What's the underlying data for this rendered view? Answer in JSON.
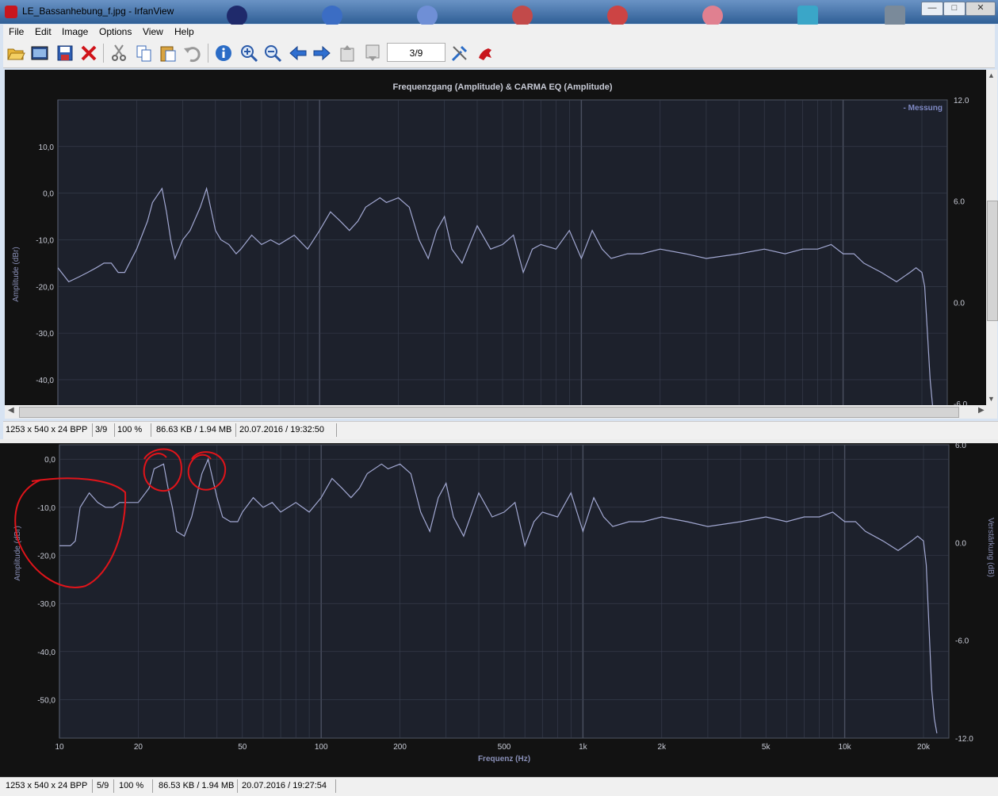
{
  "window": {
    "title": "LE_Bassanhebung_f.jpg - IrfanView",
    "controls": {
      "minimize": "—",
      "maximize": "□",
      "close": "✕"
    }
  },
  "menu": [
    "File",
    "Edit",
    "Image",
    "Options",
    "View",
    "Help"
  ],
  "toolbar": {
    "page_field": "3/9",
    "icons": [
      "open-folder-icon",
      "thumbnails-icon",
      "save-icon",
      "delete-icon",
      "cut-icon",
      "copy-icon",
      "paste-icon",
      "undo-icon",
      "info-icon",
      "zoom-in-icon",
      "zoom-out-icon",
      "previous-icon",
      "next-icon",
      "first-page-icon",
      "last-page-icon",
      "settings-icon",
      "irfanview-logo-icon"
    ]
  },
  "status_top": {
    "dims": "1253 x 540 x 24 BPP",
    "page": "3/9",
    "zoom": "100 %",
    "size": "86.63 KB / 1.94 MB",
    "date": "20.07.2016 / 19:32:50"
  },
  "status_bottom": {
    "dims": "1253 x 540 x 24 BPP",
    "page": "5/9",
    "zoom": "100 %",
    "size": "86.53 KB / 1.94 MB",
    "date": "20.07.2016 / 19:27:54"
  },
  "colors": {
    "plot_bg": "#1d212c",
    "frame_bg": "#121212",
    "line": "#a2a8d2",
    "grid": "#3a4050",
    "annotation": "#e0141a"
  },
  "chart_data": [
    {
      "type": "line",
      "title": "Frequenzgang (Amplitude) & CARMA EQ (Amplitude)",
      "ylabel": "Amplitude (dBr)",
      "ylabel_right": "",
      "xlabel": "",
      "xscale": "log",
      "legend": "- Messung",
      "legend_position": "top-right",
      "grid": true,
      "ylim": [
        -48,
        20
      ],
      "y2lim": [
        -6.8,
        12.0
      ],
      "yticks": [
        "10,0",
        "0,0",
        "-10,0",
        "-20,0",
        "-30,0",
        "-40,0"
      ],
      "y2ticks": [
        "12.0",
        "6.0",
        "0.0",
        "-6.0"
      ],
      "series": [
        {
          "name": "Messung",
          "x": [
            10,
            11,
            12,
            13,
            14,
            15,
            16,
            17,
            18,
            20,
            22,
            23,
            25,
            26,
            27,
            28,
            30,
            32,
            35,
            37,
            40,
            42,
            45,
            48,
            50,
            55,
            60,
            65,
            70,
            80,
            90,
            100,
            110,
            120,
            130,
            140,
            150,
            170,
            180,
            200,
            220,
            240,
            260,
            280,
            300,
            320,
            350,
            400,
            450,
            500,
            550,
            600,
            650,
            700,
            800,
            900,
            1000,
            1100,
            1200,
            1300,
            1500,
            1700,
            2000,
            2500,
            3000,
            4000,
            5000,
            6000,
            7000,
            8000,
            9000,
            10000,
            11000,
            12000,
            14000,
            16000,
            18000,
            19000,
            20000,
            20500,
            21000,
            21500,
            22000,
            22500
          ],
          "y": [
            -16,
            -19,
            -18,
            -17,
            -16,
            -15,
            -15,
            -17,
            -17,
            -12,
            -6,
            -2,
            1,
            -4,
            -10,
            -14,
            -10,
            -8,
            -3,
            1,
            -8,
            -10,
            -11,
            -13,
            -12,
            -9,
            -11,
            -10,
            -11,
            -9,
            -12,
            -8,
            -4,
            -6,
            -8,
            -6,
            -3,
            -1,
            -2,
            -1,
            -3,
            -10,
            -14,
            -8,
            -5,
            -12,
            -15,
            -7,
            -12,
            -11,
            -9,
            -17,
            -12,
            -11,
            -12,
            -8,
            -14,
            -8,
            -12,
            -14,
            -13,
            -13,
            -12,
            -13,
            -14,
            -13,
            -12,
            -13,
            -12,
            -12,
            -11,
            -13,
            -13,
            -15,
            -17,
            -19,
            -17,
            -16,
            -17,
            -20,
            -30,
            -40,
            -46,
            -48
          ]
        }
      ]
    },
    {
      "type": "line",
      "title": "",
      "ylabel": "Amplitude (dBr)",
      "ylabel_right": "Verstärkung (dB)",
      "xlabel": "Frequenz (Hz)",
      "xscale": "log",
      "grid": true,
      "xticks": [
        "10",
        "20",
        "50",
        "100",
        "200",
        "500",
        "1k",
        "2k",
        "5k",
        "10k",
        "20k"
      ],
      "ylim": [
        -58,
        3
      ],
      "y2lim": [
        -12.0,
        6.0
      ],
      "yticks": [
        "0,0",
        "-10,0",
        "-20,0",
        "-30,0",
        "-40,0",
        "-50,0"
      ],
      "y2ticks": [
        "6.0",
        "0.0",
        "-6.0",
        "-12.0"
      ],
      "series": [
        {
          "name": "",
          "x": [
            10,
            11,
            11.5,
            12,
            13,
            14,
            15,
            16,
            17,
            18,
            20,
            22,
            23,
            25,
            26,
            27,
            28,
            30,
            32,
            35,
            37,
            40,
            42,
            45,
            48,
            50,
            55,
            60,
            65,
            70,
            80,
            90,
            100,
            110,
            120,
            130,
            140,
            150,
            170,
            180,
            200,
            220,
            240,
            260,
            280,
            300,
            320,
            350,
            400,
            450,
            500,
            550,
            600,
            650,
            700,
            800,
            900,
            1000,
            1100,
            1200,
            1300,
            1500,
            1700,
            2000,
            2500,
            3000,
            4000,
            5000,
            6000,
            7000,
            8000,
            9000,
            10000,
            11000,
            12000,
            14000,
            16000,
            18000,
            19000,
            20000,
            20500,
            21000,
            21500,
            22000,
            22500
          ],
          "y": [
            -18,
            -18,
            -17,
            -10,
            -7,
            -9,
            -10,
            -10,
            -9,
            -9,
            -9,
            -6,
            -2,
            -1,
            -6,
            -10,
            -15,
            -16,
            -12,
            -3,
            0,
            -8,
            -12,
            -13,
            -13,
            -11,
            -8,
            -10,
            -9,
            -11,
            -9,
            -11,
            -8,
            -4,
            -6,
            -8,
            -6,
            -3,
            -1,
            -2,
            -1,
            -3,
            -11,
            -15,
            -8,
            -5,
            -12,
            -16,
            -7,
            -12,
            -11,
            -9,
            -18,
            -13,
            -11,
            -12,
            -7,
            -15,
            -8,
            -12,
            -14,
            -13,
            -13,
            -12,
            -13,
            -14,
            -13,
            -12,
            -13,
            -12,
            -12,
            -11,
            -13,
            -13,
            -15,
            -17,
            -19,
            -17,
            -16,
            -17,
            -22,
            -35,
            -48,
            -54,
            -57
          ]
        }
      ]
    }
  ]
}
